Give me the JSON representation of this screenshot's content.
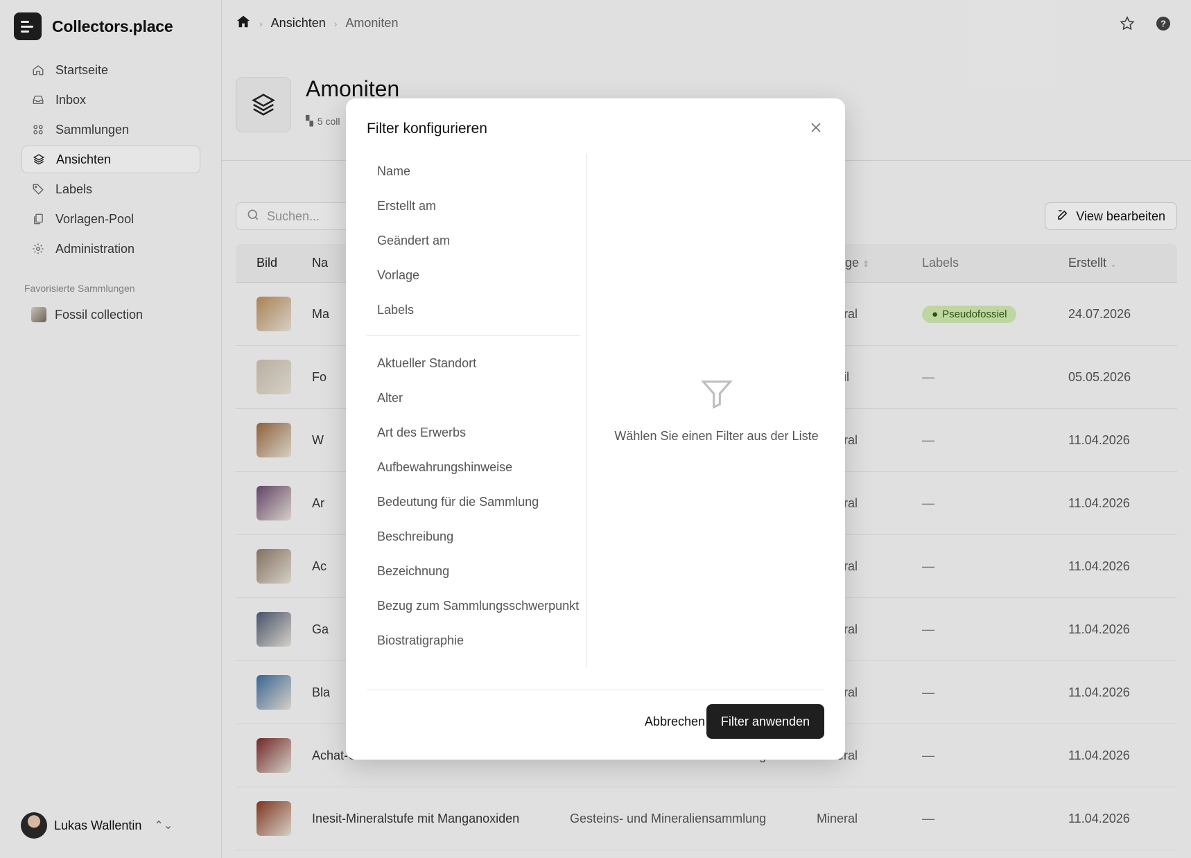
{
  "app": {
    "brand": "Collectors.place"
  },
  "sidebar": {
    "items": [
      {
        "label": "Startseite",
        "icon": "home-icon"
      },
      {
        "label": "Inbox",
        "icon": "inbox-icon"
      },
      {
        "label": "Sammlungen",
        "icon": "grid-icon"
      },
      {
        "label": "Ansichten",
        "icon": "layers-icon",
        "active": true
      },
      {
        "label": "Labels",
        "icon": "tag-icon"
      },
      {
        "label": "Vorlagen-Pool",
        "icon": "copy-icon"
      },
      {
        "label": "Administration",
        "icon": "gear-icon"
      }
    ],
    "favorites_heading": "Favorisierte Sammlungen",
    "favorites": [
      {
        "label": "Fossil collection"
      }
    ],
    "user": {
      "name": "Lukas Wallentin"
    }
  },
  "breadcrumb": [
    "Ansichten",
    "Amoniten"
  ],
  "page": {
    "title": "Amoniten",
    "subtitle": "5 coll"
  },
  "toolbar": {
    "search_placeholder": "Suchen...",
    "edit_view_label": "View bearbeiten"
  },
  "table": {
    "headers": {
      "bild": "Bild",
      "name": "Na",
      "vorlage": "Vorlage",
      "labels": "Labels",
      "erstellt": "Erstellt"
    },
    "rows": [
      {
        "name": "Ma",
        "sammlung": "",
        "vorlage": "Mineral",
        "label": "Pseudofossiel",
        "erstellt": "24.07.2026",
        "thumb": "#b98d5a"
      },
      {
        "name": "Fo",
        "sammlung": "",
        "vorlage": "Fossil",
        "label": "—",
        "erstellt": "05.05.2026",
        "thumb": "#c9bfae"
      },
      {
        "name": "W",
        "sammlung": "",
        "vorlage": "Mineral",
        "label": "—",
        "erstellt": "11.04.2026",
        "thumb": "#9a6a40"
      },
      {
        "name": "Ar",
        "sammlung": "",
        "vorlage": "Mineral",
        "label": "—",
        "erstellt": "11.04.2026",
        "thumb": "#6b4a70"
      },
      {
        "name": "Ac",
        "sammlung": "",
        "vorlage": "Mineral",
        "label": "—",
        "erstellt": "11.04.2026",
        "thumb": "#8e7a66"
      },
      {
        "name": "Ga",
        "sammlung": "",
        "vorlage": "Mineral",
        "label": "—",
        "erstellt": "11.04.2026",
        "thumb": "#4e5a74"
      },
      {
        "name": "Bla",
        "sammlung": "",
        "vorlage": "Mineral",
        "label": "—",
        "erstellt": "11.04.2026",
        "thumb": "#3f6ea0"
      },
      {
        "name": "Achat-Geode mit Kristallrand",
        "sammlung": "Gesteins- und Mineraliensammlung",
        "vorlage": "Mineral",
        "label": "—",
        "erstellt": "11.04.2026",
        "thumb": "#7a2a2a"
      },
      {
        "name": "Inesit-Mineralstufe mit Manganoxiden",
        "sammlung": "Gesteins- und Mineraliensammlung",
        "vorlage": "Mineral",
        "label": "—",
        "erstellt": "11.04.2026",
        "thumb": "#8a3a22"
      }
    ]
  },
  "modal": {
    "title": "Filter konfigurieren",
    "primary_filters": [
      "Name",
      "Erstellt am",
      "Geändert am",
      "Vorlage",
      "Labels"
    ],
    "custom_filters": [
      "Aktueller Standort",
      "Alter",
      "Art des Erwerbs",
      "Aufbewahrungshinweise",
      "Bedeutung für die Sammlung",
      "Beschreibung",
      "Bezeichnung",
      "Bezug zum Sammlungsschwerpunkt",
      "Biostratigraphie"
    ],
    "empty_text": "Wählen Sie einen Filter aus der Liste",
    "cancel_label": "Abbrechen",
    "apply_label": "Filter anwenden"
  }
}
